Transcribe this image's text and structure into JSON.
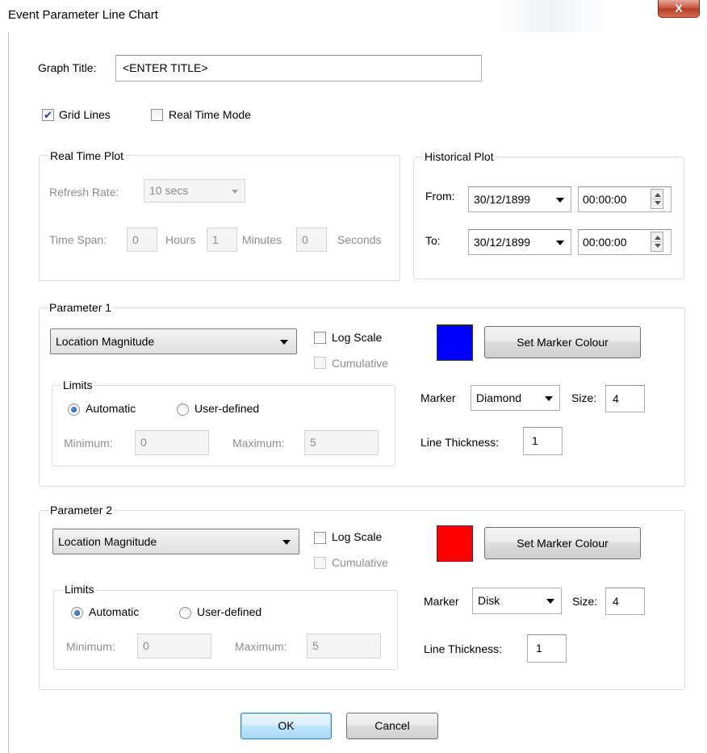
{
  "window": {
    "title": "Event Parameter Line Chart",
    "close_glyph": "X"
  },
  "graph_title": {
    "label": "Graph Title:",
    "value": "<ENTER TITLE>"
  },
  "options": {
    "grid_lines": {
      "label": "Grid Lines",
      "checked": true
    },
    "real_time_mode": {
      "label": "Real Time Mode",
      "checked": false
    }
  },
  "real_time_plot": {
    "title": "Real Time Plot",
    "refresh_rate_label": "Refresh Rate:",
    "refresh_rate_value": "10 secs",
    "time_span_label": "Time Span:",
    "hours_value": "0",
    "hours_label": "Hours",
    "minutes_value": "1",
    "minutes_label": "Minutes",
    "seconds_value": "0",
    "seconds_label": "Seconds"
  },
  "historical_plot": {
    "title": "Historical Plot",
    "from_label": "From:",
    "from_date": "30/12/1899",
    "from_time": "00:00:00",
    "to_label": "To:",
    "to_date": "30/12/1899",
    "to_time": "00:00:00"
  },
  "parameters": [
    {
      "title": "Parameter 1",
      "parameter": "Location Magnitude",
      "log_scale": "Log Scale",
      "cumulative": "Cumulative",
      "limits_title": "Limits",
      "automatic": "Automatic",
      "user_defined": "User-defined",
      "minimum_label": "Minimum:",
      "minimum_value": "0",
      "maximum_label": "Maximum:",
      "maximum_value": "5",
      "colour": "#0000ff",
      "set_colour_label": "Set Marker Colour",
      "marker_label": "Marker",
      "marker_value": "Diamond",
      "size_label": "Size:",
      "size_value": "4",
      "line_thickness_label": "Line Thickness:",
      "line_thickness_value": "1"
    },
    {
      "title": "Parameter 2",
      "parameter": "Location Magnitude",
      "log_scale": "Log Scale",
      "cumulative": "Cumulative",
      "limits_title": "Limits",
      "automatic": "Automatic",
      "user_defined": "User-defined",
      "minimum_label": "Minimum:",
      "minimum_value": "0",
      "maximum_label": "Maximum:",
      "maximum_value": "5",
      "colour": "#ff0000",
      "set_colour_label": "Set Marker Colour",
      "marker_label": "Marker",
      "marker_value": "Disk",
      "size_label": "Size:",
      "size_value": "4",
      "line_thickness_label": "Line Thickness:",
      "line_thickness_value": "1"
    }
  ],
  "buttons": {
    "ok": "OK",
    "cancel": "Cancel"
  }
}
